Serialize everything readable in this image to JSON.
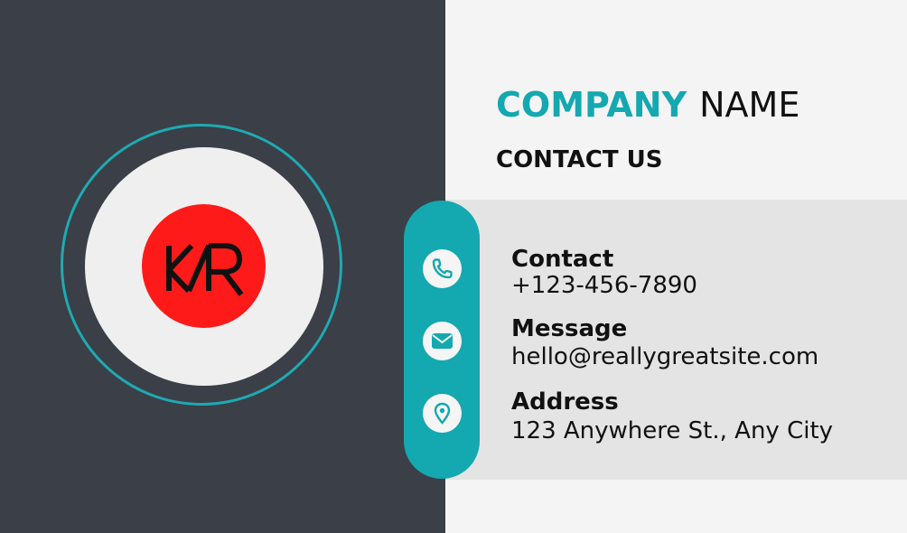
{
  "card": {
    "logo_text": "KR",
    "company_word1": "COMPANY",
    "company_word2": "NAME",
    "section_title": "CONTACT US",
    "items": [
      {
        "label": "Contact",
        "value": "+123-456-7890",
        "icon": "phone-icon"
      },
      {
        "label": "Message",
        "value": "hello@reallygreatsite.com",
        "icon": "mail-icon"
      },
      {
        "label": "Address",
        "value": "123 Anywhere St., Any City",
        "icon": "location-pin-icon"
      }
    ]
  },
  "colors": {
    "dark_panel": "#3b3f47",
    "accent_teal": "#14a8b0",
    "logo_red": "#ff1a1a",
    "light_bg": "#f4f4f4",
    "band_gray": "#e4e4e4"
  }
}
